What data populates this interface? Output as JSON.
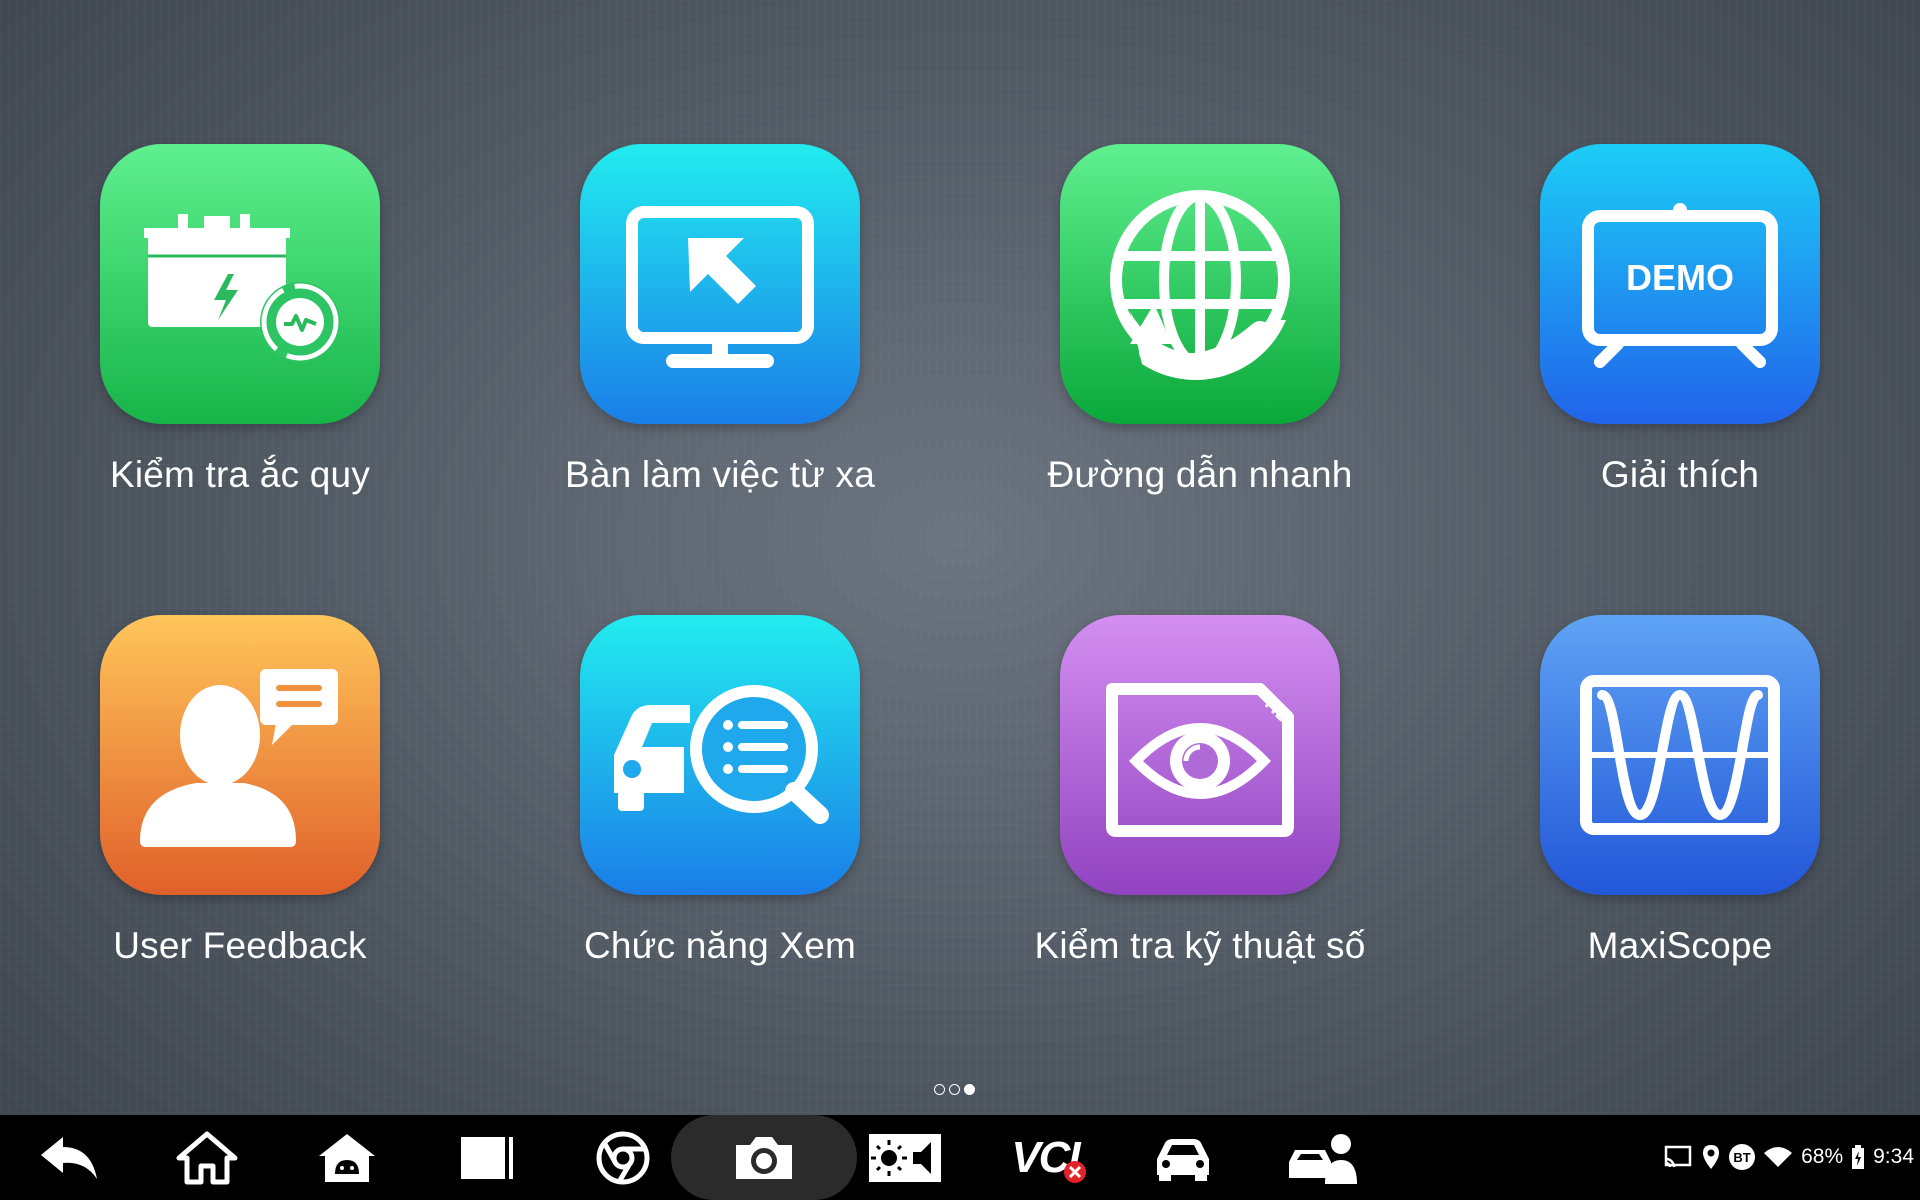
{
  "apps": [
    {
      "label": "Kiểm tra ắc quy",
      "icon": "battery-test-icon",
      "color": "#2dc463"
    },
    {
      "label": "Bàn làm việc từ xa",
      "icon": "remote-desktop-icon",
      "color": "#1fa8ec"
    },
    {
      "label": "Đường dẫn nhanh",
      "icon": "globe-refresh-icon",
      "color": "#1ec257"
    },
    {
      "label": "Giải thích",
      "icon": "demo-board-icon",
      "color": "#1f9bf0"
    },
    {
      "label": "User Feedback",
      "icon": "user-feedback-icon",
      "color": "#f0923f"
    },
    {
      "label": "Chức năng Xem",
      "icon": "car-search-icon",
      "color": "#1fa8ec"
    },
    {
      "label": "Kiểm tra kỹ thuật số",
      "icon": "eye-inspection-icon",
      "color": "#b06ad8"
    },
    {
      "label": "MaxiScope",
      "icon": "oscilloscope-wave-icon",
      "color": "#3e7fe8"
    }
  ],
  "demo_text": "DEMO",
  "hd_text": "HD",
  "pager": {
    "pages": 3,
    "active": 3
  },
  "navbar": {
    "vci_label": "VCI",
    "battery_percent": "68%",
    "clock": "9:34",
    "bt_label": "BT"
  }
}
